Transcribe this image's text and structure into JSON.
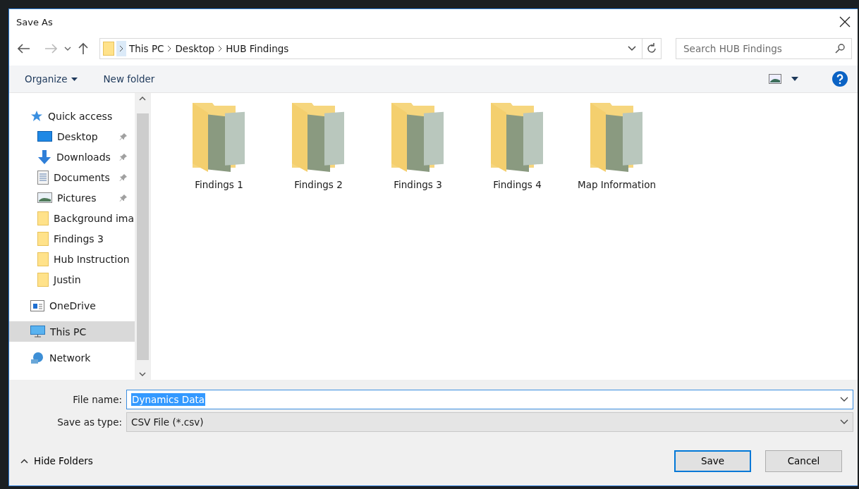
{
  "window": {
    "title": "Save As"
  },
  "address_bar": {
    "path": [
      "This PC",
      "Desktop",
      "HUB Findings"
    ]
  },
  "search": {
    "placeholder": "Search HUB Findings"
  },
  "toolbar": {
    "organize": "Organize",
    "new_folder": "New folder"
  },
  "nav": [
    {
      "kind": "quick",
      "label": "Quick access",
      "pinned": false,
      "selected": false
    },
    {
      "kind": "desktop",
      "label": "Desktop",
      "pinned": true,
      "selected": false
    },
    {
      "kind": "downloads",
      "label": "Downloads",
      "pinned": true,
      "selected": false
    },
    {
      "kind": "documents",
      "label": "Documents",
      "pinned": true,
      "selected": false
    },
    {
      "kind": "pictures",
      "label": "Pictures",
      "pinned": true,
      "selected": false
    },
    {
      "kind": "folder",
      "label": "Background ima",
      "pinned": false,
      "selected": false
    },
    {
      "kind": "folder",
      "label": "Findings 3",
      "pinned": false,
      "selected": false
    },
    {
      "kind": "folder",
      "label": "Hub Instruction",
      "pinned": false,
      "selected": false
    },
    {
      "kind": "folder",
      "label": "Justin",
      "pinned": false,
      "selected": false
    },
    {
      "kind": "onedrive",
      "label": "OneDrive",
      "pinned": false,
      "selected": false
    },
    {
      "kind": "pc",
      "label": "This PC",
      "pinned": false,
      "selected": true
    },
    {
      "kind": "network",
      "label": "Network",
      "pinned": false,
      "selected": false
    }
  ],
  "folders": [
    {
      "name": "Findings 1"
    },
    {
      "name": "Findings 2"
    },
    {
      "name": "Findings 3"
    },
    {
      "name": "Findings 4"
    },
    {
      "name": "Map Information"
    }
  ],
  "file_name": {
    "label": "File name:",
    "value": "Dynamics Data",
    "selected": true
  },
  "save_as_type": {
    "label": "Save as type:",
    "value": "CSV File (*.csv)"
  },
  "hide_folders": "Hide Folders",
  "buttons": [
    {
      "kind": "primary",
      "label": "Save"
    },
    {
      "kind": "normal",
      "label": "Cancel"
    }
  ]
}
